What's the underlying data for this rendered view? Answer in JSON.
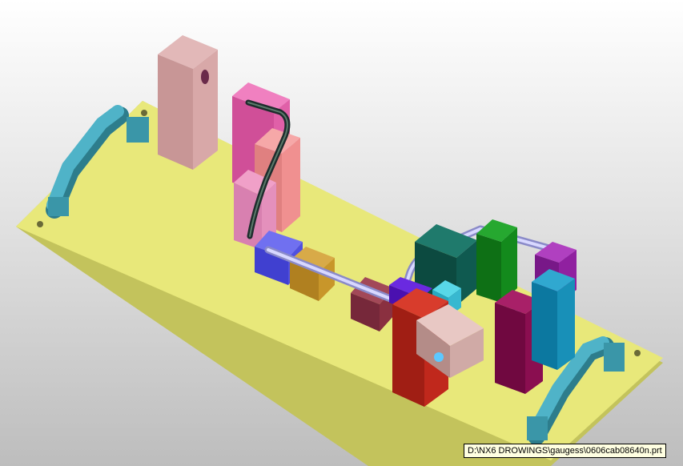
{
  "viewport": {
    "background_top": "#ffffff",
    "background_bottom": "#bdbdbd"
  },
  "model": {
    "base_plate_color": "#e8e87a",
    "handle_color": "#4fb3c8",
    "tube_color": "#b9b9f0",
    "parts": [
      {
        "name": "pink-block",
        "color": "#d8a8a8"
      },
      {
        "name": "magenta-clamp",
        "color": "#e060a8"
      },
      {
        "name": "salmon-clamp",
        "color": "#f09090"
      },
      {
        "name": "blue-clamp",
        "color": "#5050e0"
      },
      {
        "name": "ochre-clamp",
        "color": "#c8962a"
      },
      {
        "name": "maroon-clamp",
        "color": "#8a3040"
      },
      {
        "name": "red-block",
        "color": "#c0281c"
      },
      {
        "name": "teal-clamp",
        "color": "#0f5a50"
      },
      {
        "name": "green-clamp",
        "color": "#138a1c"
      },
      {
        "name": "purple-clamp",
        "color": "#9020a0"
      },
      {
        "name": "wine-clamp",
        "color": "#8a0e50"
      },
      {
        "name": "cyan-clamp",
        "color": "#1890b8"
      }
    ]
  },
  "status": {
    "file_path": "D:\\NX6 DROWINGS\\gaugess\\0606cab08640n.prt"
  }
}
